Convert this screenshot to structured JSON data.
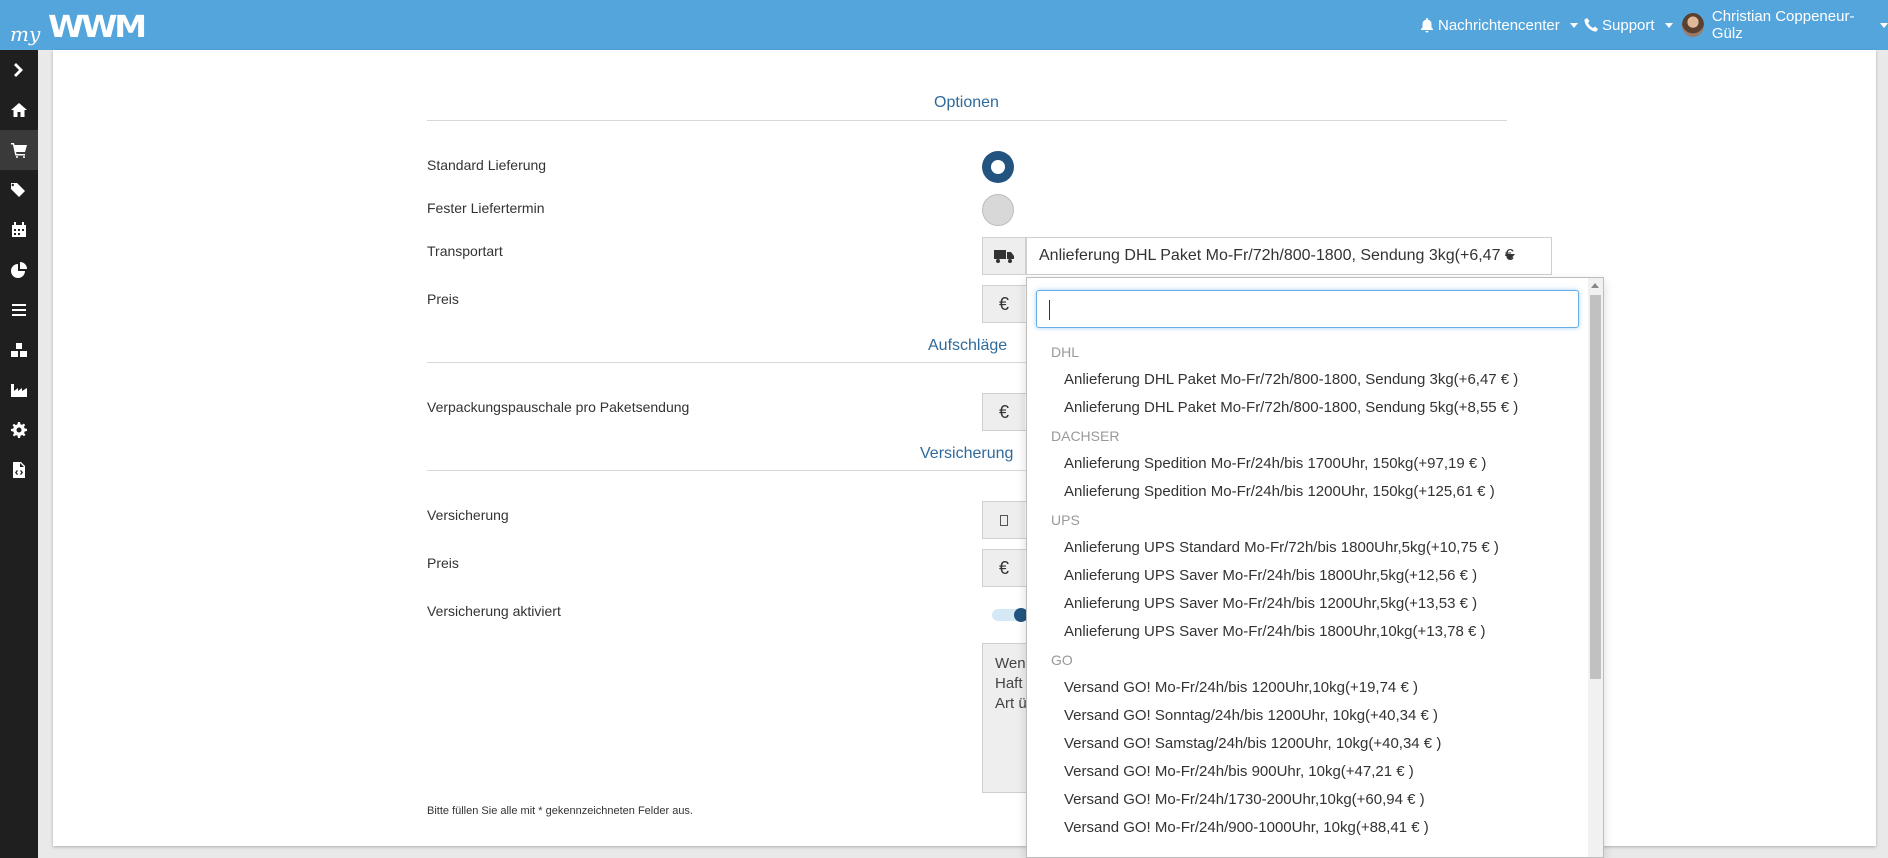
{
  "navbar": {
    "logo_my": "my",
    "logo_wwm": "WWM",
    "notifications": "Nachrichtencenter",
    "support": "Support",
    "user": "Christian Coppeneur-Gülz"
  },
  "sidebar": {
    "items": [
      "chevron-right-icon",
      "home-icon",
      "cart-icon",
      "tags-icon",
      "calendar-icon",
      "pie-chart-icon",
      "list-icon",
      "boxes-icon",
      "industry-icon",
      "gear-icon",
      "file-code-icon"
    ]
  },
  "sections": {
    "options": "Optionen",
    "surcharges": "Aufschläge",
    "insurance": "Versicherung"
  },
  "fields": {
    "standard_delivery": "Standard Lieferung",
    "fixed_date": "Fester Liefertermin",
    "transport": "Transportart",
    "price": "Preis",
    "packaging": "Verpackungspauschale pro Paketsendung",
    "insurance": "Versicherung",
    "insurance_price": "Preis",
    "insurance_active": "Versicherung aktiviert"
  },
  "currency_symbol": "€",
  "transport_selected": "Anlieferung DHL Paket Mo-Fr/72h/800-1800, Sendung 3kg(+6,47 €",
  "textarea_lines": [
    "Wen",
    "Haft",
    "Art ü"
  ],
  "footnote": "Bitte füllen Sie alle mit * gekennzeichneten Felder aus.",
  "dropdown": {
    "search_value": "",
    "groups": [
      {
        "name": "DHL",
        "options": [
          "Anlieferung DHL Paket Mo-Fr/72h/800-1800, Sendung 3kg(+6,47 € )",
          "Anlieferung DHL Paket Mo-Fr/72h/800-1800, Sendung 5kg(+8,55 € )"
        ]
      },
      {
        "name": "DACHSER",
        "options": [
          "Anlieferung Spedition Mo-Fr/24h/bis 1700Uhr, 150kg(+97,19 € )",
          "Anlieferung Spedition Mo-Fr/24h/bis 1200Uhr, 150kg(+125,61 € )"
        ]
      },
      {
        "name": "UPS",
        "options": [
          "Anlieferung UPS Standard Mo-Fr/72h/bis 1800Uhr,5kg(+10,75 € )",
          "Anlieferung UPS Saver Mo-Fr/24h/bis 1800Uhr,5kg(+12,56 € )",
          "Anlieferung UPS Saver Mo-Fr/24h/bis 1200Uhr,5kg(+13,53 € )",
          "Anlieferung UPS Saver Mo-Fr/24h/bis 1800Uhr,10kg(+13,78 € )"
        ]
      },
      {
        "name": "GO",
        "options": [
          "Versand GO! Mo-Fr/24h/bis 1200Uhr,10kg(+19,74 € )",
          "Versand GO! Sonntag/24h/bis 1200Uhr, 10kg(+40,34 € )",
          "Versand GO! Samstag/24h/bis 1200Uhr, 10kg(+40,34 € )",
          "Versand GO! Mo-Fr/24h/bis 900Uhr, 10kg(+47,21 € )",
          "Versand GO! Mo-Fr/24h/1730-200Uhr,10kg(+60,94 € )",
          "Versand GO! Mo-Fr/24h/900-1000Uhr, 10kg(+88,41 € )"
        ]
      }
    ]
  }
}
